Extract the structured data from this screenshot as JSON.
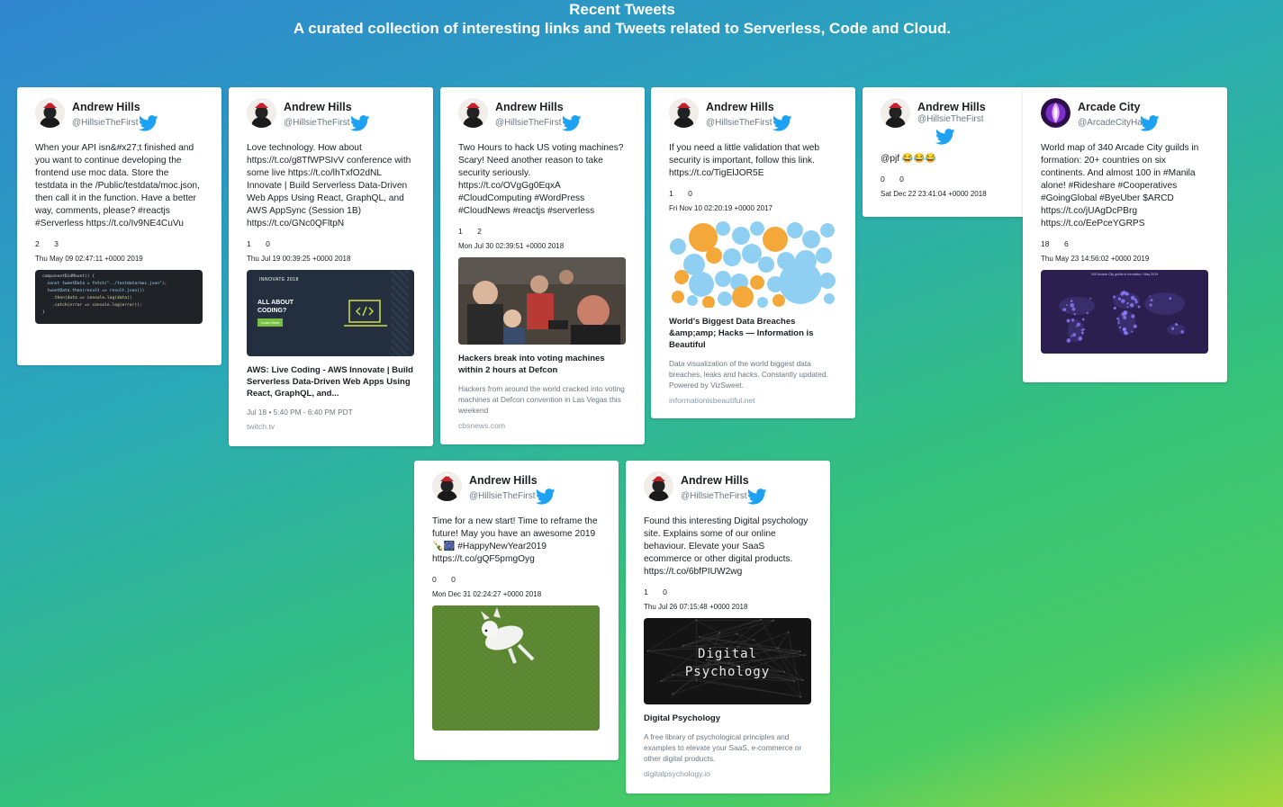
{
  "header": {
    "title": "Recent Tweets",
    "subtitle": "A curated collection of interesting links and Tweets related to Serverless, Code and Cloud."
  },
  "tweets": [
    {
      "name": "Andrew Hills",
      "handle": "@HillsieTheFirst",
      "text": "When your API isn&#x27;t finished and you want to continue developing the frontend use moc data. Store the testdata in the /Public/testdata/moc.json, then call it in the function. Have a better way, comments, please? #reactjs #Serverless https://t.co/Iv9NE4CuVu",
      "retweets": "2",
      "likes": "3",
      "date": "Thu May 09 02:47:11 +0000 2019",
      "code_lines": [
        "componentDidMount() {",
        "  const tweetData = fetch(\"../testdata/moc.json\");",
        "  tweetData.then(result => result.json())",
        "    .then(data => console.log(data))",
        "    .catch(error => console.log(error));",
        "}"
      ]
    },
    {
      "name": "Andrew Hills",
      "handle": "@HillsieTheFirst",
      "text": "Love technology. How about https://t.co/g8TfWPSIvV conference with some live https://t.co/lhTxfO2dNL Innovate | Build Serverless Data-Driven Web Apps Using React, GraphQL, and AWS AppSync (Session 1B) https://t.co/GNc0QFltpN",
      "retweets": "1",
      "likes": "0",
      "date": "Thu Jul 19 00:39:25 +0000 2018",
      "banner": {
        "top": "INNOVATE 2018",
        "line1": "ALL ABOUT",
        "line2": "CODING?",
        "cta": "Learn More"
      },
      "link_title": "AWS: Live Coding - AWS Innovate | Build Serverless Data-Driven Web Apps Using React, GraphQL, and...",
      "link_meta": "Jul 18 • 5:40 PM - 6:40 PM PDT",
      "link_domain": "twitch.tv"
    },
    {
      "name": "Andrew Hills",
      "handle": "@HillsieTheFirst",
      "text": "Two Hours to hack US voting machines? Scary! Need another reason to take security seriously. https://t.co/OVgGg0EqxA #CloudComputing #WordPress #CloudNews #reactjs #serverless",
      "retweets": "1",
      "likes": "2",
      "date": "Mon Jul 30 02:39:51 +0000 2018",
      "link_title": "Hackers break into voting machines within 2 hours at Defcon",
      "link_desc": "Hackers from around the world cracked into voting machines at Defcon convention in Las Vegas this weekend",
      "link_domain": "cbsnews.com"
    },
    {
      "name": "Andrew Hills",
      "handle": "@HillsieTheFirst",
      "text": "If you need a little validation that web security is important, follow this link. https://t.co/TigElJOR5E",
      "retweets": "1",
      "likes": "0",
      "date": "Fri Nov 10 02:20:19 +0000 2017",
      "link_title": "World's Biggest Data Breaches &amp;amp; Hacks — Information is Beautiful",
      "link_desc": "Data visualization of the world biggest data breaches, leaks and hacks. Constantly updated. Powered by VizSweet.",
      "link_domain": "informationisbeautiful.net"
    },
    {
      "name": "Andrew Hills",
      "handle": "@HillsieTheFirst",
      "text": "@pjf 😂😂😂",
      "retweets": "0",
      "likes": "0",
      "date": "Sat Dec 22 23:41:04 +0000 2018"
    },
    {
      "name": "Arcade City",
      "handle": "@ArcadeCityHall",
      "text": "World map of 340 Arcade City guilds in formation: 20+ countries on six continents. And almost 100 in #Manila alone! #Rideshare #Cooperatives #GoingGlobal #ByeUber $ARCD https://t.co/jUAgDcPBrg https://t.co/EePceYGRPS",
      "retweets": "18",
      "likes": "6",
      "date": "Thu May 23 14:56:02 +0000 2019",
      "map_caption": "340 Arcade City guilds in formation / May 2019"
    },
    {
      "name": "Andrew Hills",
      "handle": "@HillsieTheFirst",
      "text": "Time for a new start! Time to reframe the future! May you have an awesome 2019 🍾🎆 #HappyNewYear2019 https://t.co/gQF5pmgOyg",
      "retweets": "0",
      "likes": "0",
      "date": "Mon Dec 31 02:24:27 +0000 2018"
    },
    {
      "name": "Andrew Hills",
      "handle": "@HillsieTheFirst",
      "text": "Found this interesting Digital psychology site. Explains some of our online behaviour. Elevate your SaaS ecommerce or other digital products. https://t.co/6bfPIUW2wg",
      "retweets": "1",
      "likes": "0",
      "date": "Thu Jul 26 07:15:48 +0000 2018",
      "image_text_1": "Digital",
      "image_text_2": "Psychology",
      "link_title": "Digital Psychology",
      "link_desc": "A free library of psychological principles and examples to elevate your SaaS, e-commerce or other digital products.",
      "link_domain": "digitalpsychology.io"
    }
  ],
  "colors": {
    "twitter_blue": "#1da1f2",
    "bubble_orange": "#f5a83a",
    "bubble_blue": "#8fd0f2",
    "map_bg": "#2a1f4f"
  }
}
